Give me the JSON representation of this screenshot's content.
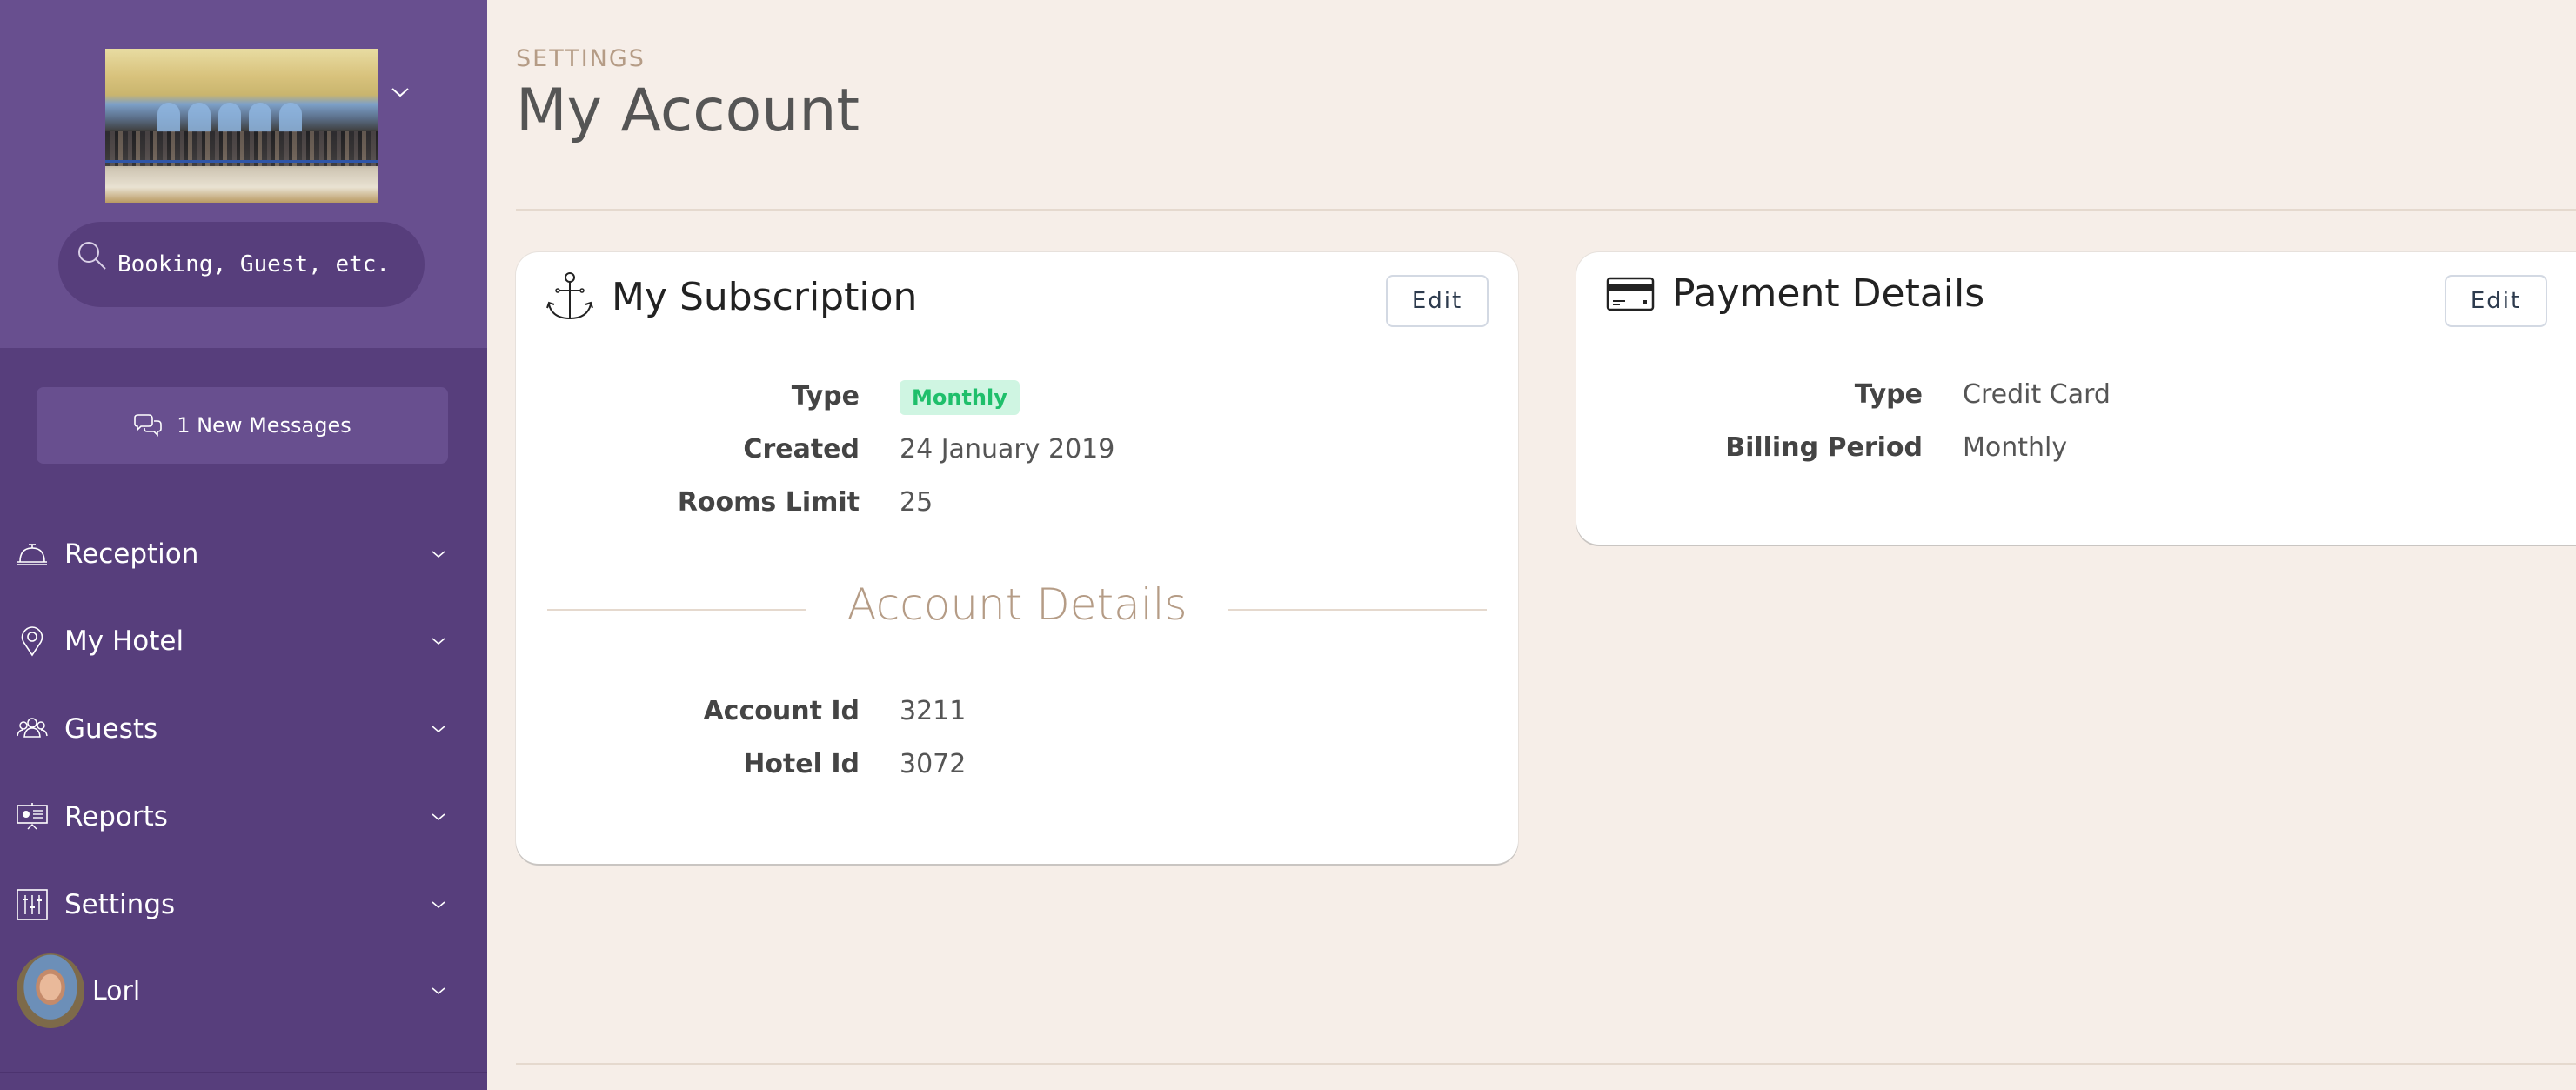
{
  "sidebar": {
    "search": {
      "placeholder": "Booking, Guest, etc.",
      "value": ""
    },
    "messages_label": "1 New Messages",
    "nav": [
      {
        "label": "Reception",
        "icon": "bell-icon"
      },
      {
        "label": "My Hotel",
        "icon": "map-pin-icon"
      },
      {
        "label": "Guests",
        "icon": "users-icon"
      },
      {
        "label": "Reports",
        "icon": "presentation-icon"
      },
      {
        "label": "Settings",
        "icon": "sliders-icon"
      }
    ],
    "user": {
      "name": "Lorl"
    }
  },
  "main": {
    "breadcrumb": "SETTINGS",
    "title": "My Account",
    "subscription": {
      "title": "My Subscription",
      "edit_label": "Edit",
      "fields": [
        {
          "label": "Type",
          "value": "Monthly"
        },
        {
          "label": "Created",
          "value": "24 January 2019"
        },
        {
          "label": "Rooms Limit",
          "value": "25"
        }
      ],
      "section_title": "Account Details",
      "account_fields": [
        {
          "label": "Account Id",
          "value": "3211"
        },
        {
          "label": "Hotel Id",
          "value": "3072"
        }
      ]
    },
    "payment": {
      "title": "Payment Details",
      "edit_label": "Edit",
      "fields": [
        {
          "label": "Type",
          "value": "Credit Card"
        },
        {
          "label": "Billing Period",
          "value": "Monthly"
        }
      ]
    }
  },
  "colors": {
    "sidebar": "#573e7c",
    "sidebar_header": "#684f8f",
    "background": "#f6eee8",
    "badge_bg": "#cff5e2",
    "badge_text": "#1fbf6b",
    "accent_tan": "#b59c86"
  }
}
